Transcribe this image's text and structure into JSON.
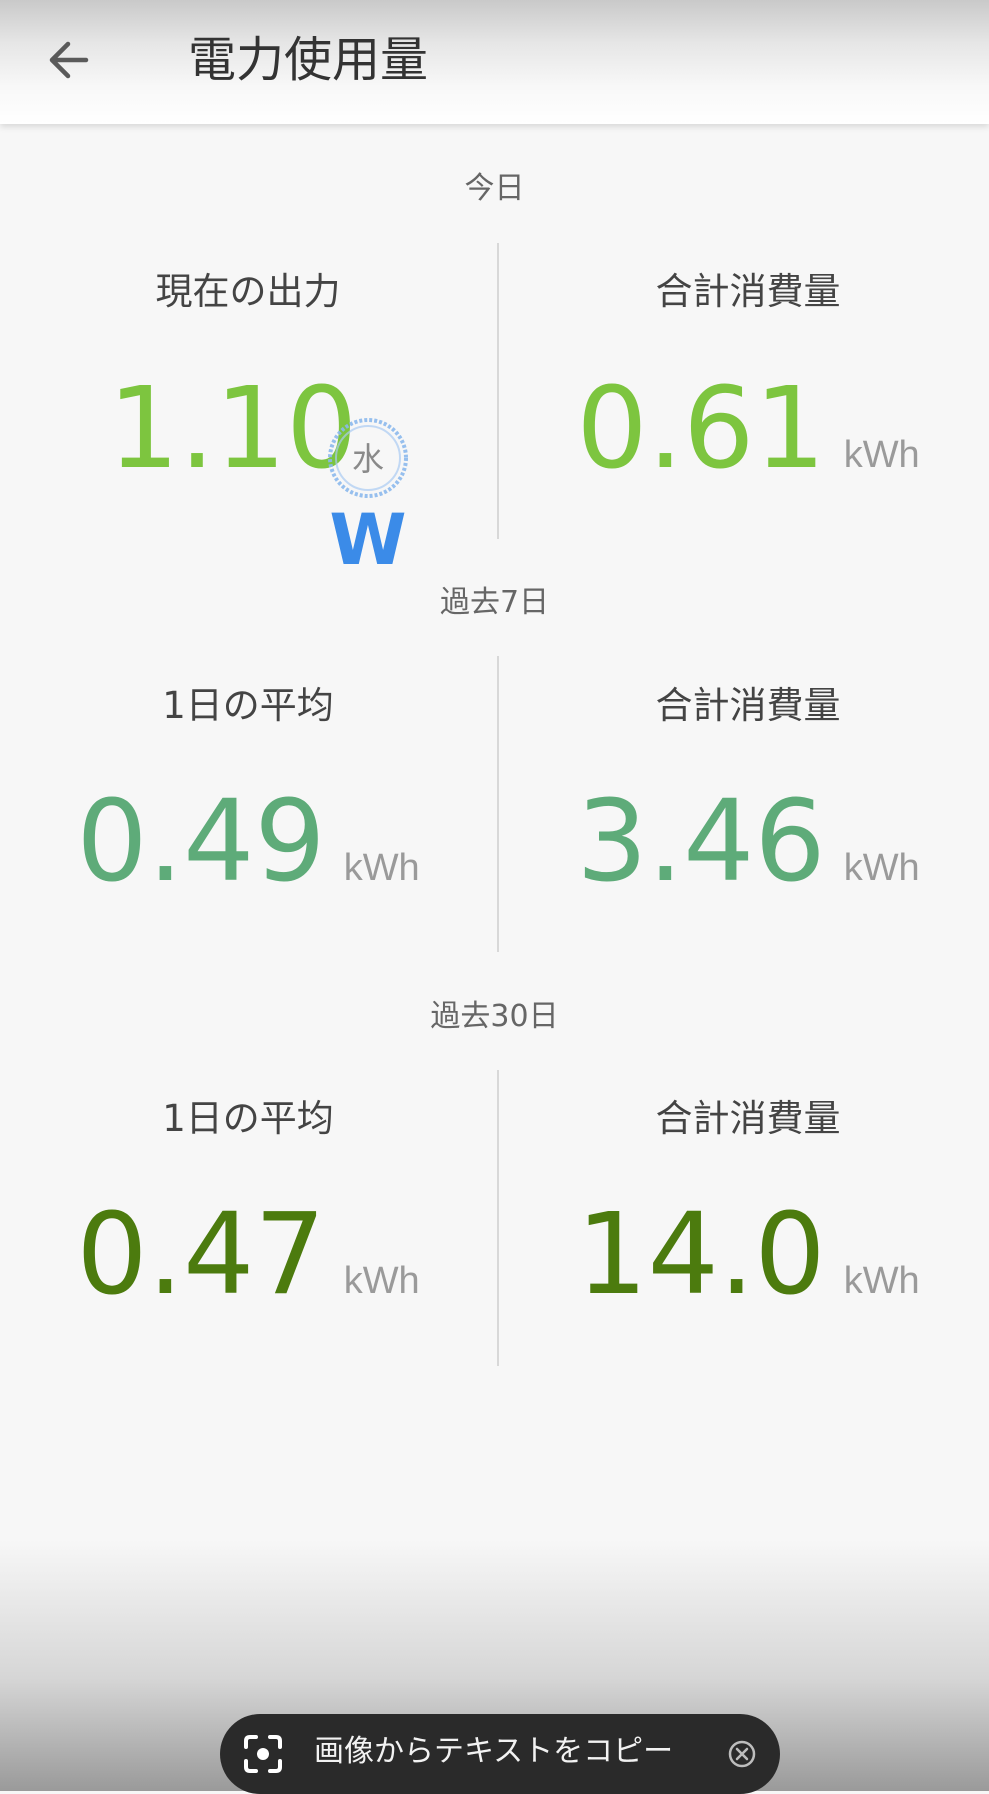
{
  "header": {
    "back_icon": "arrow-back-icon",
    "title": "電力使用量"
  },
  "sections": {
    "today": {
      "label": "今日",
      "left_label": "現在の出力",
      "left_value": "1.10",
      "left_unit": "W",
      "left_unit_circle_text": "水",
      "right_label": "合計消費量",
      "right_value": "0.61",
      "right_unit": "kWh"
    },
    "last7": {
      "label": "過去7日",
      "left_label": "1日の平均",
      "left_value": "0.49",
      "left_unit": "kWh",
      "right_label": "合計消費量",
      "right_value": "3.46",
      "right_unit": "kWh"
    },
    "last30": {
      "label": "過去30日",
      "left_label": "1日の平均",
      "left_value": "0.47",
      "left_unit": "kWh",
      "right_label": "合計消費量",
      "right_value": "14.0",
      "right_unit": "kWh"
    }
  },
  "copy_bar": {
    "text": "画像からテキストをコピー",
    "scan_icon": "text-scan-icon",
    "close_icon": "close-circle-icon"
  },
  "colors": {
    "today": "#7dc53f",
    "last7": "#5eab79",
    "last30": "#4c7b0e",
    "unit": "#9a9a9a",
    "handwriting": "#3b8be8"
  }
}
